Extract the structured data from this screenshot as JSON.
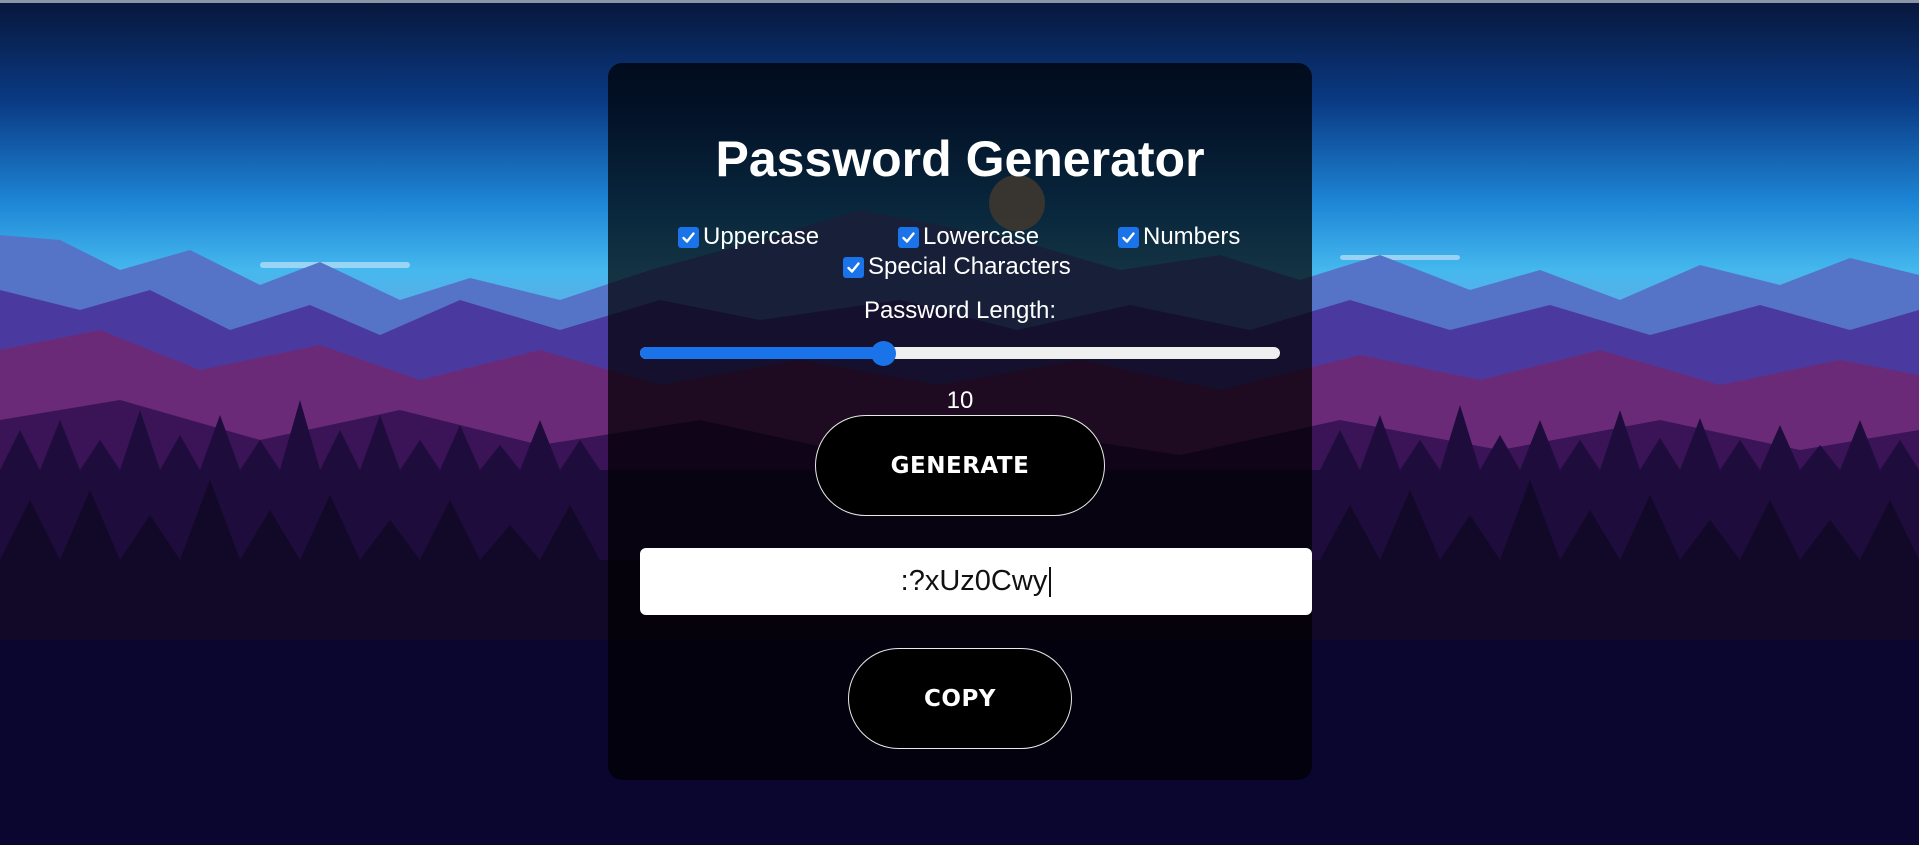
{
  "app": {
    "title": "Password Generator"
  },
  "options": [
    {
      "label": "Uppercase",
      "checked": true,
      "icon": "checkbox-checked-icon"
    },
    {
      "label": "Lowercase",
      "checked": true,
      "icon": "checkbox-checked-icon"
    },
    {
      "label": "Numbers",
      "checked": true,
      "icon": "checkbox-checked-icon"
    },
    {
      "label": "Special Characters",
      "checked": true,
      "icon": "checkbox-checked-icon"
    }
  ],
  "length": {
    "label": "Password Length:",
    "value": "10",
    "slider_fraction": 0.38
  },
  "buttons": {
    "generate": "GENERATE",
    "copy": "COPY"
  },
  "output": {
    "value": ":?xUz0Cwy"
  },
  "colors": {
    "accent": "#1a73e8",
    "card_background": "rgba(0,0,0,0.72)",
    "button_background": "#000000",
    "text": "#ffffff"
  }
}
